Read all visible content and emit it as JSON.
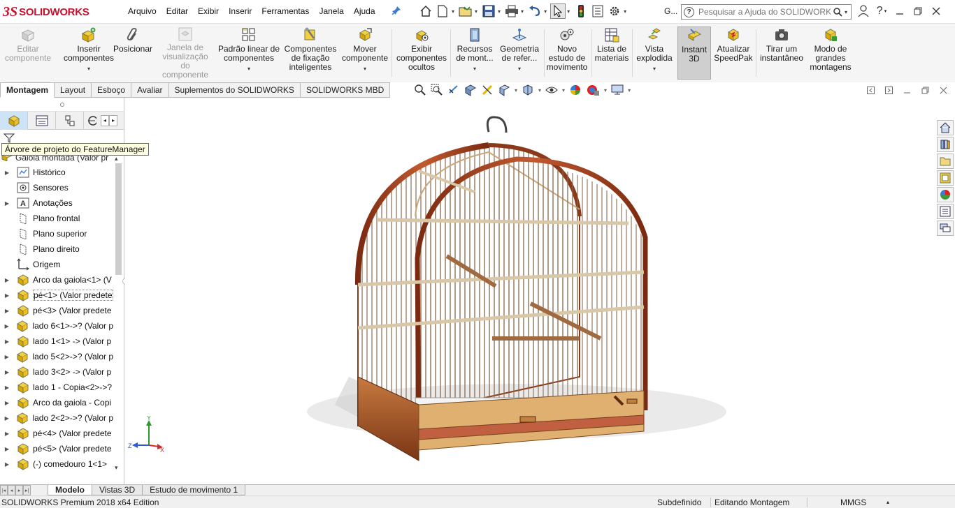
{
  "app": {
    "brand_prefix": "3S",
    "brand": "SOLIDWORKS"
  },
  "menu": [
    "Arquivo",
    "Editar",
    "Exibir",
    "Inserir",
    "Ferramentas",
    "Janela",
    "Ajuda"
  ],
  "toolbar": {
    "overflow_label": "G..."
  },
  "search": {
    "placeholder": "Pesquisar a Ajuda do SOLIDWORKS"
  },
  "ribbon": {
    "buttons": [
      {
        "label": "Editar componente",
        "disabled": true,
        "icon": "edit-component-icon"
      },
      {
        "label": "Inserir componentes",
        "disabled": false,
        "icon": "insert-components-icon",
        "dropdown": true
      },
      {
        "label": "Posicionar",
        "disabled": false,
        "icon": "mate-paperclip-icon"
      },
      {
        "label": "Janela de visualização do componente",
        "disabled": true,
        "icon": "component-preview-icon"
      },
      {
        "label": "Padrão linear de componentes",
        "disabled": false,
        "icon": "linear-pattern-icon",
        "dropdown": true
      },
      {
        "label": "Componentes de fixação inteligentes",
        "disabled": false,
        "icon": "smart-fasteners-icon"
      },
      {
        "label": "Mover componente",
        "disabled": false,
        "icon": "move-component-icon",
        "dropdown": true
      },
      {
        "label": "Exibir componentes ocultos",
        "disabled": false,
        "icon": "show-hidden-icon"
      },
      {
        "label": "Recursos de mont...",
        "disabled": false,
        "icon": "assembly-features-icon",
        "dropdown": true
      },
      {
        "label": "Geometria de refer...",
        "disabled": false,
        "icon": "reference-geometry-icon",
        "dropdown": true
      },
      {
        "label": "Novo estudo de movimento",
        "disabled": false,
        "icon": "motion-study-icon"
      },
      {
        "label": "Lista de materiais",
        "disabled": false,
        "icon": "bill-of-materials-icon"
      },
      {
        "label": "Vista explodida",
        "disabled": false,
        "icon": "exploded-view-icon",
        "dropdown": true
      },
      {
        "label": "Instant 3D",
        "disabled": false,
        "icon": "instant-3d-icon",
        "active": true
      },
      {
        "label": "Atualizar SpeedPak",
        "disabled": false,
        "icon": "speedpak-icon"
      },
      {
        "label": "Tirar um instantâneo",
        "disabled": false,
        "icon": "camera-icon"
      },
      {
        "label": "Modo de grandes montagens",
        "disabled": false,
        "icon": "large-assembly-icon"
      }
    ]
  },
  "command_tabs": [
    "Montagem",
    "Layout",
    "Esboço",
    "Avaliar",
    "Suplementos do SOLIDWORKS",
    "SOLIDWORKS MBD"
  ],
  "feature_manager": {
    "tooltip": "Árvore de projeto do FeatureManager",
    "root": "Gaiola montada  (Valor pr",
    "items": [
      {
        "label": "Histórico",
        "icon": "history-icon",
        "expandable": true
      },
      {
        "label": "Sensores",
        "icon": "sensor-icon",
        "expandable": false
      },
      {
        "label": "Anotações",
        "icon": "annotations-icon",
        "expandable": true
      },
      {
        "label": "Plano frontal",
        "icon": "plane-icon",
        "expandable": false
      },
      {
        "label": "Plano superior",
        "icon": "plane-icon",
        "expandable": false
      },
      {
        "label": "Plano direito",
        "icon": "plane-icon",
        "expandable": false
      },
      {
        "label": "Origem",
        "icon": "origin-icon",
        "expandable": false
      },
      {
        "label": "Arco da gaiola<1> (V",
        "icon": "part-icon",
        "expandable": true
      },
      {
        "label": "pé<1> (Valor predete",
        "icon": "part-icon",
        "expandable": true,
        "highlight": true
      },
      {
        "label": "pé<3> (Valor predete",
        "icon": "part-icon",
        "expandable": true
      },
      {
        "label": "lado 6<1>->? (Valor p",
        "icon": "part-icon",
        "expandable": true
      },
      {
        "label": "lado 1<1> -> (Valor p",
        "icon": "part-icon",
        "expandable": true
      },
      {
        "label": "lado 5<2>->? (Valor p",
        "icon": "part-icon",
        "expandable": true
      },
      {
        "label": "lado 3<2> -> (Valor p",
        "icon": "part-icon",
        "expandable": true
      },
      {
        "label": "lado 1 - Copia<2>->?",
        "icon": "part-icon",
        "expandable": true
      },
      {
        "label": "Arco da gaiola - Copi",
        "icon": "part-icon",
        "expandable": true
      },
      {
        "label": "lado 2<2>->? (Valor p",
        "icon": "part-icon",
        "expandable": true
      },
      {
        "label": "pé<4> (Valor predete",
        "icon": "part-icon",
        "expandable": true
      },
      {
        "label": "pé<5> (Valor predete",
        "icon": "part-icon",
        "expandable": true
      },
      {
        "label": "(-) comedouro 1<1>",
        "icon": "part-icon",
        "expandable": true
      }
    ]
  },
  "triad": {
    "x": "X",
    "y": "Y",
    "z": "Z"
  },
  "bottom_tabs": [
    "Modelo",
    "Vistas 3D",
    "Estudo de movimento 1"
  ],
  "status": {
    "product": "SOLIDWORKS Premium 2018 x64 Edition",
    "definition": "Subdefinido",
    "mode": "Editando Montagem",
    "units": "MMGS"
  },
  "colors": {
    "brand": "#c8102e",
    "accent": "#3a7bd5",
    "part": "#e8b800",
    "wood": "#a0522d"
  }
}
